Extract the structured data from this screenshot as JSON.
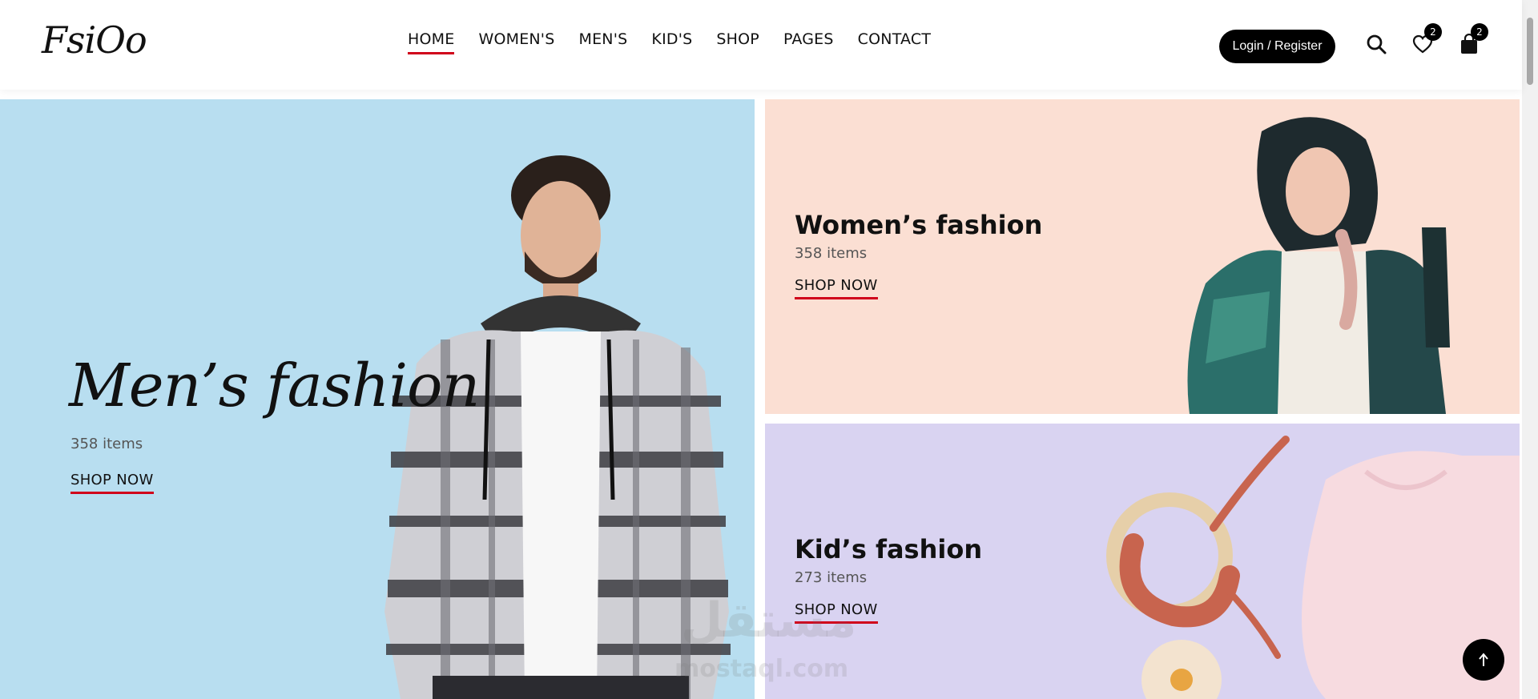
{
  "header": {
    "logo": "FsiOo",
    "nav": [
      {
        "label": "HOME",
        "active": true
      },
      {
        "label": "WOMEN'S",
        "active": false
      },
      {
        "label": "MEN'S",
        "active": false
      },
      {
        "label": "KID'S",
        "active": false
      },
      {
        "label": "SHOP",
        "active": false
      },
      {
        "label": "PAGES",
        "active": false
      },
      {
        "label": "CONTACT",
        "active": false
      }
    ],
    "login_label": "Login / Register",
    "wishlist_count": "2",
    "cart_count": "2"
  },
  "banners": {
    "men": {
      "title": "Men’s fashion",
      "count": "358 items",
      "cta": "SHOP NOW",
      "color": "#b8def0"
    },
    "women": {
      "title": "Women’s fashion",
      "count": "358 items",
      "cta": "SHOP NOW",
      "color": "#fbdfd3"
    },
    "kids": {
      "title": "Kid’s fashion",
      "count": "273 items",
      "cta": "SHOP NOW",
      "color": "#d9d3f1"
    }
  },
  "watermark": {
    "arabic": "مستقل",
    "latin": "mostaql.com"
  },
  "colors": {
    "accent": "#d0021b",
    "dark": "#000000"
  },
  "icons": {
    "search": "search-icon",
    "wishlist": "heart-icon",
    "cart": "bag-icon",
    "to_top": "arrow-up-icon"
  }
}
